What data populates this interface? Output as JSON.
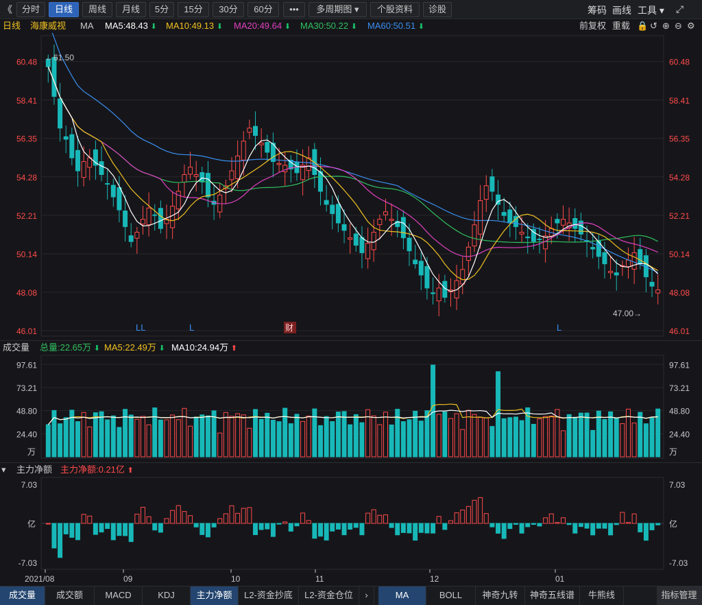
{
  "toolbar": {
    "back": "《",
    "periods": [
      "分时",
      "日线",
      "周线",
      "月线",
      "5分",
      "15分",
      "30分",
      "60分"
    ],
    "more": "•••",
    "multi": "多周期图 ▾",
    "info": "个股资料",
    "diag": "诊股",
    "right": [
      "筹码",
      "画线",
      "工具 ▾"
    ],
    "expand": "⤢"
  },
  "main": {
    "period": "日线",
    "stock": "海康威视",
    "ma_label": "MA",
    "ma": [
      {
        "label": "MA5:48.43",
        "color": "#ffffff"
      },
      {
        "label": "MA10:49.13",
        "color": "#f0c020"
      },
      {
        "label": "MA20:49.64",
        "color": "#e040c0"
      },
      {
        "label": "MA30:50.22",
        "color": "#30c060"
      },
      {
        "label": "MA60:50.51",
        "color": "#3a8ef0"
      }
    ],
    "right_controls": [
      "前复权",
      "重载"
    ],
    "high_label": "←61.50",
    "low_label": "47.00→",
    "caijing": "财",
    "signals": [
      "LL",
      "L",
      "L"
    ]
  },
  "volume": {
    "title": "成交量",
    "total": "总量:22.65万",
    "ma5": "MA5:22.49万",
    "ma10": "MA10:24.94万",
    "unit": "万"
  },
  "net": {
    "title": "主力净额",
    "value": "主力净额:0.21亿",
    "unit": "亿"
  },
  "dates": [
    "2021/08",
    "09",
    "10",
    "11",
    "12",
    "01"
  ],
  "bottom_tabs": [
    "成交量",
    "成交额",
    "MACD",
    "KDJ",
    "主力净额",
    "L2-资金抄底",
    "L2-资金仓位"
  ],
  "bottom_tabs_right": [
    "MA",
    "BOLL",
    "神奇九转",
    "神奇五线谱",
    "牛熊线",
    "指标管理"
  ],
  "colors": {
    "up": "#ff4a4a",
    "down": "#18b8b8",
    "ma5": "#ffffff",
    "ma10": "#f0c020",
    "ma20": "#e040c0",
    "ma30": "#30c060",
    "ma60": "#3a8ef0"
  },
  "chart_data": {
    "type": "candlestick",
    "ylim": [
      46.01,
      61.5
    ],
    "yticks": [
      "60.48",
      "58.41",
      "56.35",
      "54.28",
      "52.21",
      "50.14",
      "48.08",
      "46.01"
    ],
    "vol_yticks": [
      "97.61",
      "73.21",
      "48.80",
      "24.40"
    ],
    "net_yticks": [
      "7.03",
      "-7.03"
    ],
    "closes": [
      60.2,
      58.6,
      56.9,
      56.3,
      55.3,
      54.6,
      55.1,
      55.3,
      54.9,
      54.4,
      53.9,
      53.2,
      52.5,
      51.6,
      50.8,
      51.3,
      52.0,
      52.6,
      52.2,
      51.5,
      52.0,
      52.7,
      53.5,
      54.4,
      54.8,
      54.4,
      54.0,
      53.2,
      52.8,
      53.3,
      53.8,
      54.6,
      55.4,
      56.2,
      56.9,
      56.5,
      56.1,
      55.6,
      55.1,
      55.0,
      54.9,
      54.7,
      54.5,
      54.9,
      55.3,
      54.4,
      53.5,
      52.8,
      52.3,
      51.8,
      51.4,
      51.0,
      50.6,
      50.2,
      50.7,
      51.3,
      52.0,
      52.4,
      52.0,
      51.6,
      51.0,
      50.3,
      49.6,
      49.0,
      48.3,
      48.0,
      48.3,
      47.8,
      48.2,
      48.7,
      49.3,
      50.5,
      51.7,
      53.0,
      53.8,
      53.5,
      52.8,
      52.2,
      51.8,
      51.6,
      51.3,
      51.0,
      50.8,
      50.9,
      51.1,
      51.5,
      51.8,
      52.0,
      51.8,
      51.5,
      51.2,
      50.8,
      50.4,
      50.0,
      49.6,
      49.2,
      49.0,
      49.5,
      49.8,
      50.2,
      49.6,
      48.9,
      48.4,
      48.2
    ]
  }
}
